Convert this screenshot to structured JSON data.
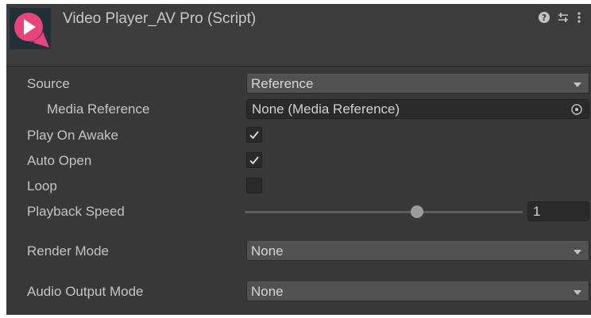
{
  "component": {
    "title": "Video Player_AV Pro (Script)",
    "logo": "av-pro-play-logo",
    "header_icons": [
      "help-icon",
      "preset-sliders-icon",
      "more-menu-icon"
    ]
  },
  "fields": {
    "source": {
      "label": "Source",
      "value": "Reference"
    },
    "media_reference": {
      "label": "Media Reference",
      "value": "None (Media Reference)"
    },
    "play_on_awake": {
      "label": "Play On Awake",
      "checked": true
    },
    "auto_open": {
      "label": "Auto Open",
      "checked": true
    },
    "loop": {
      "label": "Loop",
      "checked": false
    },
    "playback_speed": {
      "label": "Playback Speed",
      "value": "1",
      "slider_fraction": 0.62
    },
    "render_mode": {
      "label": "Render Mode",
      "value": "None"
    },
    "audio_output_mode": {
      "label": "Audio Output Mode",
      "value": "None"
    }
  },
  "colors": {
    "panel_bg": "#383838",
    "logo_pink": "#e8437a",
    "logo_dark": "#1f3036"
  }
}
